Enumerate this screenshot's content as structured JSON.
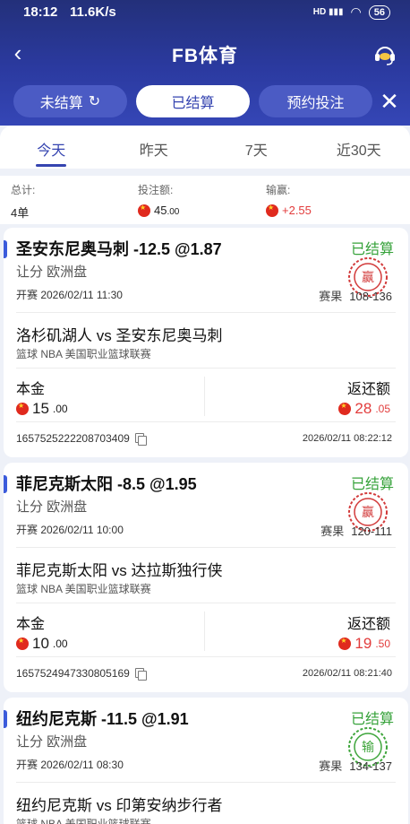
{
  "status_bar": {
    "time": "18:12",
    "speed": "11.6K/s",
    "signal": "HD",
    "battery": "56"
  },
  "nav": {
    "title": "FB体育"
  },
  "segments": [
    {
      "label": "未结算"
    },
    {
      "label": "已结算"
    },
    {
      "label": "预约投注"
    }
  ],
  "tabs": [
    {
      "label": "今天"
    },
    {
      "label": "昨天"
    },
    {
      "label": "7天"
    },
    {
      "label": "近30天"
    }
  ],
  "summary": {
    "total_label": "总计:",
    "total_value": "4单",
    "stake_label": "投注额:",
    "stake_value": "45",
    "stake_decimals": ".00",
    "win_label": "输赢:",
    "win_value": "+2.55"
  },
  "bets": [
    {
      "title": "圣安东尼奥马刺 -12.5 @1.87",
      "status": "已结算",
      "market": "让分  欧洲盘",
      "start": "开赛  2026/02/11 11:30",
      "score_label": "赛果",
      "score": "108-136",
      "match": "洛杉矶湖人 vs 圣安东尼奥马刺",
      "league": "篮球   NBA 美国职业篮球联赛",
      "principal_label": "本金",
      "principal": "15",
      "principal_dec": ".00",
      "return_label": "返还额",
      "return": "28",
      "return_dec": ".05",
      "order_id": "1657525222208703409",
      "order_time": "2026/02/11 08:22:12",
      "stamp_color": "#d23a3a"
    },
    {
      "title": "菲尼克斯太阳 -8.5 @1.95",
      "status": "已结算",
      "market": "让分  欧洲盘",
      "start": "开赛  2026/02/11 10:00",
      "score_label": "赛果",
      "score": "120-111",
      "match": "菲尼克斯太阳 vs 达拉斯独行侠",
      "league": "篮球   NBA 美国职业篮球联赛",
      "principal_label": "本金",
      "principal": "10",
      "principal_dec": ".00",
      "return_label": "返还额",
      "return": "19",
      "return_dec": ".50",
      "order_id": "1657524947330805169",
      "order_time": "2026/02/11 08:21:40",
      "stamp_color": "#d23a3a"
    },
    {
      "title": "纽约尼克斯 -11.5 @1.91",
      "status": "已结算",
      "market": "让分  欧洲盘",
      "start": "开赛  2026/02/11 08:30",
      "score_label": "赛果",
      "score": "134-137",
      "match": "纽约尼克斯 vs 印第安纳步行者",
      "league": "篮球   NBA 美国职业篮球联赛",
      "stamp_color": "#3ea53b"
    }
  ]
}
